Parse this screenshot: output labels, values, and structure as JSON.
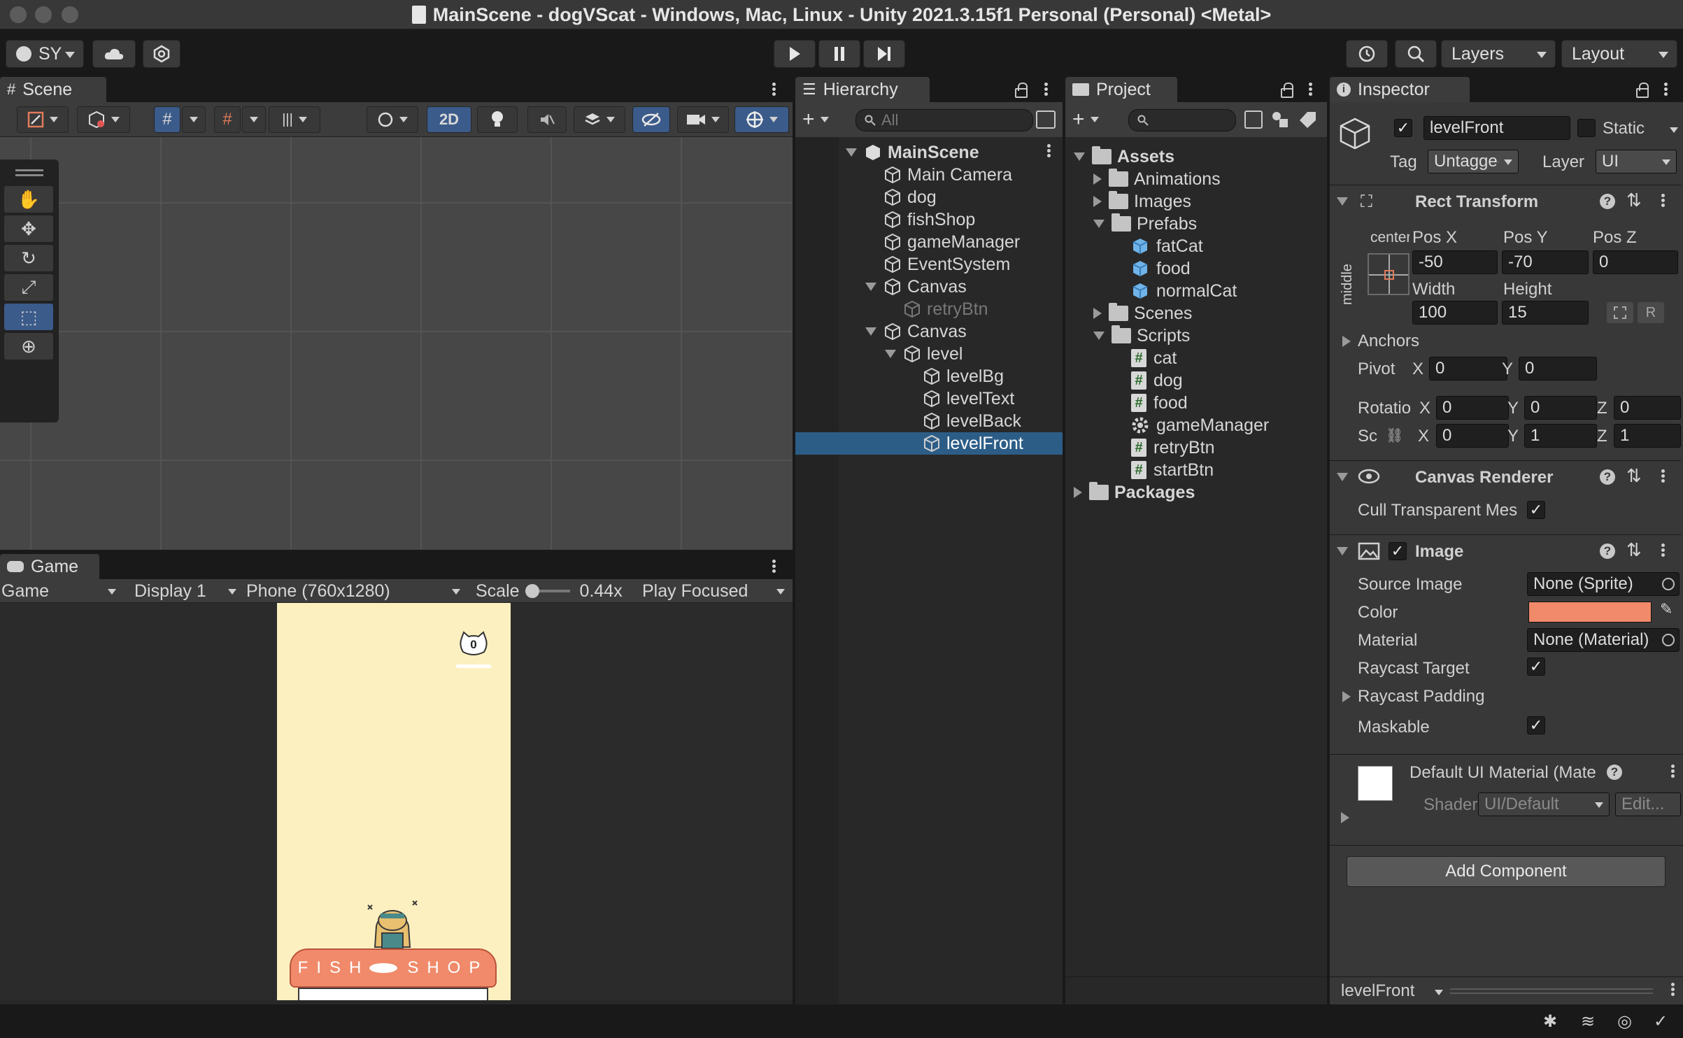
{
  "window": {
    "title": "MainScene - dogVScat - Windows, Mac, Linux - Unity 2021.3.15f1 Personal (Personal) <Metal>"
  },
  "toolbar": {
    "account_label": "SY",
    "layers_label": "Layers",
    "layout_label": "Layout"
  },
  "scene": {
    "tab_label": "Scene",
    "mode_2d_label": "2D"
  },
  "game": {
    "tab_label": "Game",
    "view_select": "Game",
    "display_select": "Display 1",
    "resolution_select": "Phone (760x1280)",
    "scale_label": "Scale",
    "scale_value": "0.44x",
    "scale_fraction": 0.1,
    "play_mode_select": "Play Focused",
    "score_text": "0",
    "sign_left": "FISH",
    "sign_right": "SHOP"
  },
  "hierarchy": {
    "tab_label": "Hierarchy",
    "search_placeholder": "All",
    "items": [
      {
        "label": "MainScene"
      },
      {
        "label": "Main Camera"
      },
      {
        "label": "dog"
      },
      {
        "label": "fishShop"
      },
      {
        "label": "gameManager"
      },
      {
        "label": "EventSystem"
      },
      {
        "label": "Canvas"
      },
      {
        "label": "retryBtn"
      },
      {
        "label": "Canvas"
      },
      {
        "label": "level"
      },
      {
        "label": "levelBg"
      },
      {
        "label": "levelText"
      },
      {
        "label": "levelBack"
      },
      {
        "label": "levelFront"
      }
    ]
  },
  "project": {
    "tab_label": "Project",
    "items": [
      {
        "label": "Assets"
      },
      {
        "label": "Animations"
      },
      {
        "label": "Images"
      },
      {
        "label": "Prefabs"
      },
      {
        "label": "fatCat"
      },
      {
        "label": "food"
      },
      {
        "label": "normalCat"
      },
      {
        "label": "Scenes"
      },
      {
        "label": "Scripts"
      },
      {
        "label": "cat"
      },
      {
        "label": "dog"
      },
      {
        "label": "food"
      },
      {
        "label": "gameManager"
      },
      {
        "label": "retryBtn"
      },
      {
        "label": "startBtn"
      },
      {
        "label": "Packages"
      }
    ]
  },
  "inspector": {
    "tab_label": "Inspector",
    "object_name": "levelFront",
    "static_label": "Static",
    "tag_label": "Tag",
    "tag_value": "Untagged",
    "layer_label": "Layer",
    "layer_value": "UI",
    "rect_transform": {
      "title": "Rect Transform",
      "anchor_h": "center",
      "anchor_v": "middle",
      "pos_x_label": "Pos X",
      "pos_x": "-50",
      "pos_y_label": "Pos Y",
      "pos_y": "-70",
      "pos_z_label": "Pos Z",
      "pos_z": "0",
      "width_label": "Width",
      "width": "100",
      "height_label": "Height",
      "height": "15",
      "r_label": "R",
      "anchors_label": "Anchors",
      "pivot_label": "Pivot",
      "pivot_x_label": "X",
      "pivot_x": "0",
      "pivot_y_label": "Y",
      "pivot_y": "0",
      "rotation_label": "Rotatio",
      "rot_x_label": "X",
      "rot_x": "0",
      "rot_y_label": "Y",
      "rot_y": "0",
      "rot_z_label": "Z",
      "rot_z": "0",
      "scale_label": "Sc",
      "scale_x_label": "X",
      "scale_x": "0",
      "scale_y_label": "Y",
      "scale_y": "1",
      "scale_z_label": "Z",
      "scale_z": "1"
    },
    "canvas_renderer": {
      "title": "Canvas Renderer",
      "cull_label": "Cull Transparent Mes"
    },
    "image": {
      "title": "Image",
      "source_image_label": "Source Image",
      "source_image_value": "None (Sprite)",
      "color_label": "Color",
      "color_value": "#f08a6a",
      "material_label": "Material",
      "material_value": "None (Material)",
      "raycast_target_label": "Raycast Target",
      "raycast_padding_label": "Raycast Padding",
      "maskable_label": "Maskable"
    },
    "material": {
      "title": "Default UI Material (Mate",
      "shader_label": "Shader",
      "shader_value": "UI/Default",
      "edit_label": "Edit..."
    },
    "add_component_label": "Add Component",
    "footer_label": "levelFront"
  },
  "colors": {
    "selection": "#2c5d87",
    "accent_blue": "#3b5b8a",
    "game_bg": "#fdf0c0",
    "sign": "#f08a6a"
  }
}
